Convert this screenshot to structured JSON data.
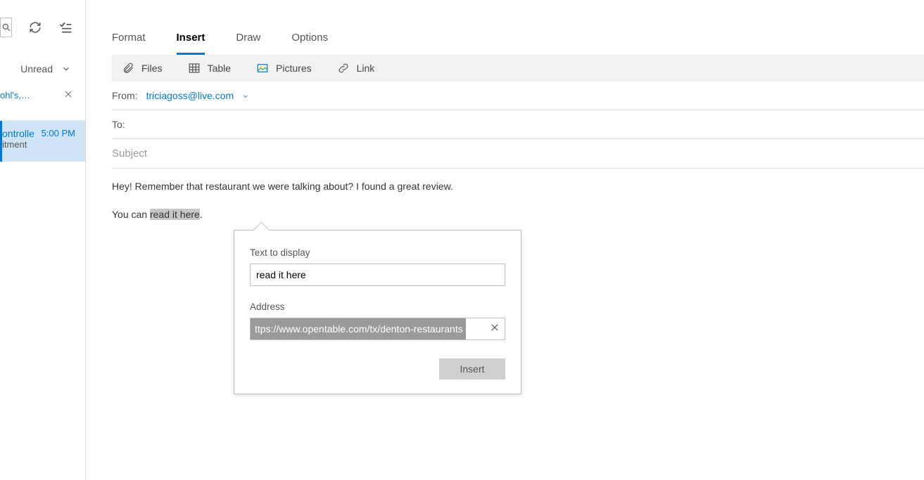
{
  "leftPanel": {
    "unreadLabel": "Unread",
    "item1": {
      "truncated": "ohl's,…"
    },
    "item2": {
      "sender": "ontrolle",
      "time": "5:00 PM",
      "preview": "itment"
    }
  },
  "tabs": {
    "format": "Format",
    "insert": "Insert",
    "draw": "Draw",
    "options": "Options"
  },
  "ribbon": {
    "files": "Files",
    "table": "Table",
    "pictures": "Pictures",
    "link": "Link"
  },
  "compose": {
    "fromLabel": "From:",
    "fromEmail": "triciagoss@live.com",
    "toLabel": "To:",
    "subjectPlaceholder": "Subject",
    "bodyLine1": "Hey! Remember that restaurant we were talking about? I found a great review.",
    "bodyPrefix": "You can ",
    "bodyHighlighted": "read it here",
    "bodySuffix": "."
  },
  "linkPopup": {
    "textLabel": "Text to display",
    "textValue": "read it here",
    "addressLabel": "Address",
    "addressValue": "ttps://www.opentable.com/tx/denton-restaurants",
    "insertLabel": "Insert"
  }
}
